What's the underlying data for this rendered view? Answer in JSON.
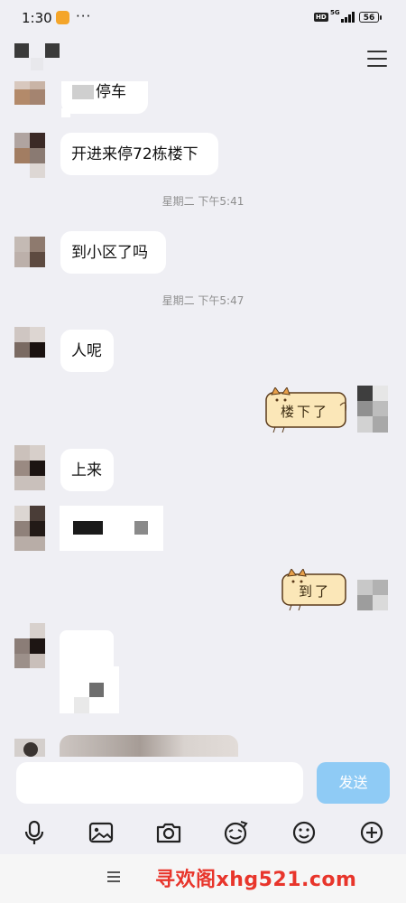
{
  "status_bar": {
    "time": "1:30",
    "dots": "···",
    "hd": "HD",
    "network": "5G",
    "battery": "56"
  },
  "messages": {
    "partial_text": "停车",
    "m1": "开进来停72栋楼下",
    "time1": "星期二 下午5:41",
    "m2": "到小区了吗",
    "time2": "星期二 下午5:47",
    "m3": "人呢",
    "sticker1": "楼下了",
    "m4": "上来",
    "sticker2": "到了"
  },
  "input": {
    "value": "",
    "send_label": "发送"
  },
  "toolbar": {
    "icons": [
      "microphone-icon",
      "image-icon",
      "camera-icon",
      "emoji-sticker-icon",
      "smiley-icon",
      "plus-icon"
    ]
  },
  "watermark": "寻欢阁xhg521.com",
  "colors": {
    "background": "#efeff4",
    "send_button": "#8fcbf5",
    "watermark": "#e8352b"
  }
}
